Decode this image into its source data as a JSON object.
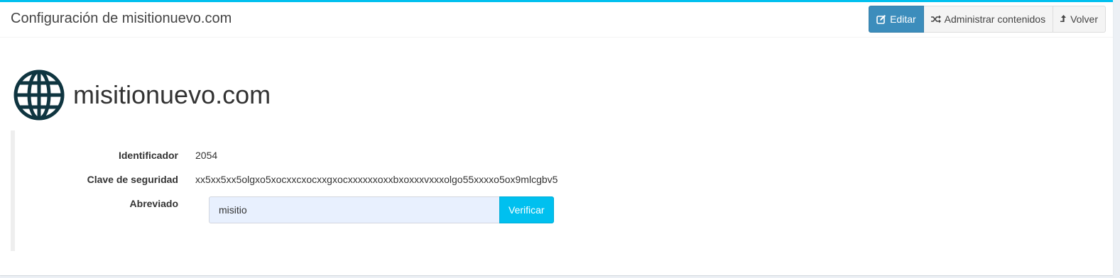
{
  "header": {
    "title": "Configuración de misitionuevo.com",
    "buttons": [
      {
        "label": "Editar",
        "icon": "edit-icon"
      },
      {
        "label": "Administrar contenidos",
        "icon": "shuffle-icon"
      },
      {
        "label": "Volver",
        "icon": "level-up-icon"
      }
    ]
  },
  "site": {
    "icon": "globe-icon",
    "name": "misitionuevo.com"
  },
  "details": {
    "identificador_label": "Identificador",
    "identificador_value": "2054",
    "clave_label": "Clave de seguridad",
    "clave_value": "xx5xx5xx5olgxo5xocxxcxocxxgxocxxxxxxoxxbxoxxxvxxxolgo55xxxxo5ox9mlcgbv5",
    "abreviado_label": "Abreviado",
    "abreviado_value": "misitio",
    "verify_label": "Verificar"
  },
  "colors": {
    "accent": "#00c0ef",
    "primary": "#3c8dbc",
    "globe": "#0f3540"
  }
}
